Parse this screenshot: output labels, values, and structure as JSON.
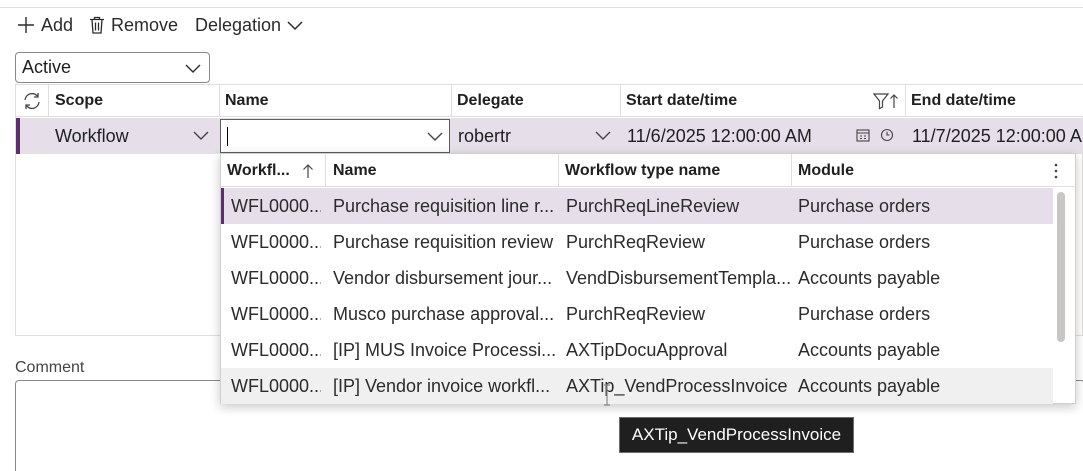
{
  "toolbar": {
    "add_label": "Add",
    "remove_label": "Remove",
    "delegation_label": "Delegation"
  },
  "filter": {
    "selected": "Active"
  },
  "grid": {
    "columns": {
      "scope": "Scope",
      "name": "Name",
      "delegate": "Delegate",
      "start": "Start date/time",
      "end": "End date/time"
    },
    "row": {
      "scope": "Workflow",
      "name": "",
      "delegate": "robertr",
      "start": "11/6/2025 12:00:00 AM",
      "end": "11/7/2025 12:00:00 A"
    }
  },
  "comment_label": "Comment",
  "lookup": {
    "columns": {
      "id": "Workfl...",
      "name": "Name",
      "type": "Workflow type name",
      "module": "Module"
    },
    "rows": [
      {
        "id": "WFL0000...",
        "name": "Purchase requisition line r...",
        "type": "PurchReqLineReview",
        "module": "Purchase orders"
      },
      {
        "id": "WFL0000...",
        "name": "Purchase requisition review",
        "type": "PurchReqReview",
        "module": "Purchase orders"
      },
      {
        "id": "WFL0000...",
        "name": "Vendor disbursement jour...",
        "type": "VendDisbursementTempla...",
        "module": "Accounts payable"
      },
      {
        "id": "WFL0000...",
        "name": "Musco purchase approval...",
        "type": "PurchReqReview",
        "module": "Purchase orders"
      },
      {
        "id": "WFL0000...",
        "name": "[IP] MUS Invoice Processi...",
        "type": "AXTipDocuApproval",
        "module": "Accounts payable"
      },
      {
        "id": "WFL0000...",
        "name": "[IP] Vendor invoice workfl...",
        "type": "AXTip_VendProcessInvoice",
        "module": "Accounts payable"
      }
    ]
  },
  "tooltip": "AXTip_VendProcessInvoice",
  "colors": {
    "accent": "#5c2e6e",
    "row_selected": "#e6dfe9",
    "row_hover": "#f0f0f0"
  }
}
